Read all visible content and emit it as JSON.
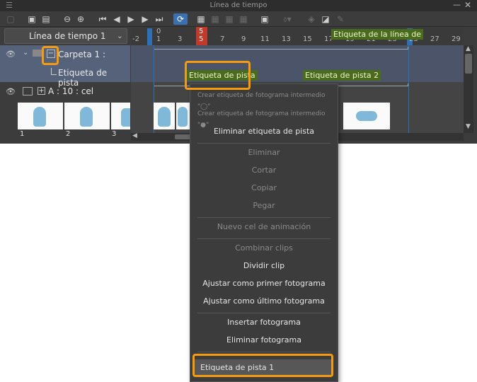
{
  "window": {
    "title": "Línea de tiempo"
  },
  "timeline_select": {
    "value": "Línea de tiempo 1"
  },
  "ruler": {
    "ticks": [
      "-2",
      "0\n1",
      "3",
      "5\n5",
      "7",
      "9",
      "11",
      "13",
      "15",
      "17",
      "19",
      "21",
      "23",
      "25",
      "27",
      "29"
    ],
    "current_frame": "5"
  },
  "layers": {
    "folder": {
      "label": "Carpeta 1 :"
    },
    "track_label": {
      "label": "Etiqueta de pista"
    },
    "anim_layer": {
      "label": "A : 10 : cel"
    }
  },
  "track_labels": {
    "timeline_label": "Etiqueta de la línea de",
    "label1": "Etiqueta de pista",
    "label2": "Etiqueta de pista 2"
  },
  "thumbnails": [
    "1",
    "2",
    "3"
  ],
  "context_menu": {
    "items": [
      {
        "label": "Crear etiqueta de fotograma intermedio \"◯\"",
        "disabled": true
      },
      {
        "label": "Crear etiqueta de fotograma intermedio \"●\"",
        "disabled": true
      },
      {
        "label": "Eliminar etiqueta de pista",
        "disabled": false
      },
      {
        "label": "Eliminar",
        "disabled": true
      },
      {
        "label": "Cortar",
        "disabled": true
      },
      {
        "label": "Copiar",
        "disabled": true
      },
      {
        "label": "Pegar",
        "disabled": true
      },
      {
        "label": "Nuevo cel de animación",
        "disabled": true
      },
      {
        "label": "Combinar clips",
        "disabled": true
      },
      {
        "label": "Dividir clip",
        "disabled": false
      },
      {
        "label": "Ajustar como primer fotograma",
        "disabled": false
      },
      {
        "label": "Ajustar como último fotograma",
        "disabled": false
      },
      {
        "label": "Insertar fotograma",
        "disabled": false
      },
      {
        "label": "Eliminar fotograma",
        "disabled": false
      },
      {
        "label": "Etiqueta de pista 1",
        "disabled": false
      }
    ]
  },
  "colors": {
    "highlight": "#f39c12",
    "track_label_bg": "#4a6b1e",
    "current_frame": "#c0392b",
    "loop_marker": "#2f6fb3"
  }
}
